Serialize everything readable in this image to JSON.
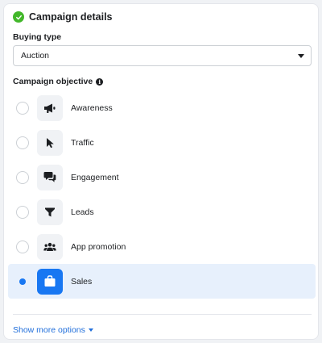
{
  "header": {
    "title": "Campaign details",
    "status_icon": "check-circle-icon",
    "status_color": "#42b72a"
  },
  "buying_type": {
    "label": "Buying type",
    "selected": "Auction"
  },
  "objective": {
    "label": "Campaign objective",
    "info_icon": "info-icon",
    "items": [
      {
        "label": "Awareness",
        "icon": "megaphone-icon",
        "selected": false
      },
      {
        "label": "Traffic",
        "icon": "cursor-icon",
        "selected": false
      },
      {
        "label": "Engagement",
        "icon": "chat-bubbles-icon",
        "selected": false
      },
      {
        "label": "Leads",
        "icon": "funnel-icon",
        "selected": false
      },
      {
        "label": "App promotion",
        "icon": "people-icon",
        "selected": false
      },
      {
        "label": "Sales",
        "icon": "shopping-bag-icon",
        "selected": true
      }
    ]
  },
  "footer": {
    "show_more_label": "Show more options"
  },
  "colors": {
    "accent": "#1877f2",
    "selected_row_bg": "#e7f0fc",
    "link": "#216fdb"
  }
}
